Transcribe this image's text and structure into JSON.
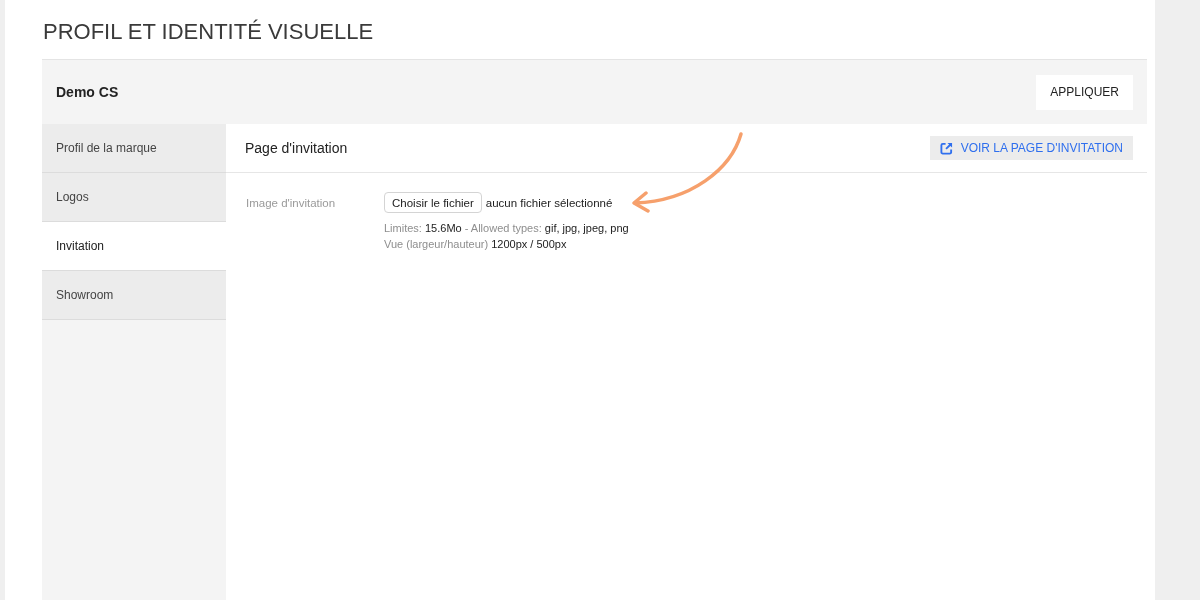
{
  "page_title": "PROFIL ET IDENTITÉ VISUELLE",
  "header": {
    "brand": "Demo CS",
    "apply_button": "APPLIQUER"
  },
  "sidebar": {
    "items": [
      {
        "label": "Profil de la marque",
        "selected": false
      },
      {
        "label": "Logos",
        "selected": false
      },
      {
        "label": "Invitation",
        "selected": true
      },
      {
        "label": "Showroom",
        "selected": false
      }
    ]
  },
  "section": {
    "title": "Page d'invitation",
    "view_button": "VOIR LA PAGE D'INVITATION",
    "fields": [
      {
        "label": "Image d'invitation",
        "file_button": "Choisir le fichier",
        "file_status": "aucun fichier sélectionné",
        "hints": [
          "Limites: **15.6Mo** - Allowed types: **gif, jpg, jpeg, png**",
          "Vue (largeur/hauteur) **1200px / 500px**"
        ]
      }
    ]
  }
}
